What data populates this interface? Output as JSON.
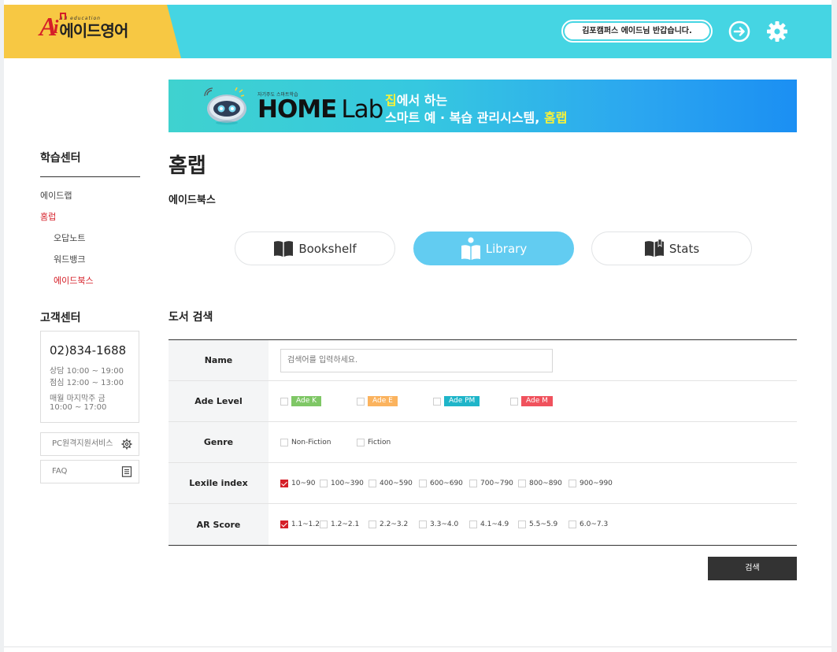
{
  "header": {
    "logo_mark": "A",
    "logo_sub": "A.I education",
    "logo_name": "에이드영어",
    "greeting": "김포캠퍼스 에이드님 반갑습니다.",
    "logout_icon": "logout-icon",
    "settings_icon": "gear-icon",
    "colors": {
      "bar": "#45d5e3",
      "logo_bg": "#f7c843",
      "brand_red": "#d51f28"
    }
  },
  "banner": {
    "tagline_small": "자기주도 스마트학습",
    "home": "HOME",
    "lab": "Lab",
    "line1_highlight": "집",
    "line1_rest": "에서 하는",
    "line2_rest": "스마트 예 · 복습 관리시스템, ",
    "line2_highlight": "홈랩"
  },
  "sidebar": {
    "title": "학습센터",
    "items": [
      {
        "label": "에이드랩",
        "active": false
      },
      {
        "label": "홈럽",
        "active": true
      },
      {
        "label": "오답노트",
        "active": false
      },
      {
        "label": "워드뱅크",
        "active": false
      },
      {
        "label": "에이드북스",
        "active": true
      }
    ],
    "cs_title": "고객센터",
    "cs": {
      "phone": "02)834-1688",
      "hours1": "상담 10:00 ~ 19:00",
      "hours2": "점심 12:00 ~ 13:00",
      "hours3": "매월 마지막주 금",
      "hours4": "10:00 ~ 17:00"
    },
    "remote_label": "PC원격지원서비스",
    "faq_label": "FAQ"
  },
  "main": {
    "page_title": "홈랩",
    "sub_title": "에이드북스",
    "tabs": [
      {
        "label": "Bookshelf",
        "icon": "book-icon",
        "active": false
      },
      {
        "label": "Library",
        "icon": "reader-icon",
        "active": true
      },
      {
        "label": "Stats",
        "icon": "bookmark-book-icon",
        "active": false
      }
    ],
    "section_title": "도서 검색",
    "form": {
      "name_label": "Name",
      "name_placeholder": "검색어를 입력하세요.",
      "level_label": "Ade Level",
      "levels": [
        {
          "label": "Ade K",
          "color": "#7fc766"
        },
        {
          "label": "Ade E",
          "color": "#fbb35e"
        },
        {
          "label": "Ade PM",
          "color": "#1fb5c9"
        },
        {
          "label": "Ade M",
          "color": "#f0525d"
        }
      ],
      "genre_label": "Genre",
      "genres": [
        "Non-Fiction",
        "Fiction"
      ],
      "lexile_label": "Lexile index",
      "lexile": [
        {
          "label": "10~90",
          "checked": true
        },
        {
          "label": "100~390",
          "checked": false
        },
        {
          "label": "400~590",
          "checked": false
        },
        {
          "label": "600~690",
          "checked": false
        },
        {
          "label": "700~790",
          "checked": false
        },
        {
          "label": "800~890",
          "checked": false
        },
        {
          "label": "900~990",
          "checked": false
        }
      ],
      "ar_label": "AR Score",
      "ar": [
        {
          "label": "1.1~1.2",
          "checked": true
        },
        {
          "label": "1.2~2.1",
          "checked": false
        },
        {
          "label": "2.2~3.2",
          "checked": false
        },
        {
          "label": "3.3~4.0",
          "checked": false
        },
        {
          "label": "4.1~4.9",
          "checked": false
        },
        {
          "label": "5.5~5.9",
          "checked": false
        },
        {
          "label": "6.0~7.3",
          "checked": false
        }
      ]
    },
    "search_button": "검색"
  }
}
